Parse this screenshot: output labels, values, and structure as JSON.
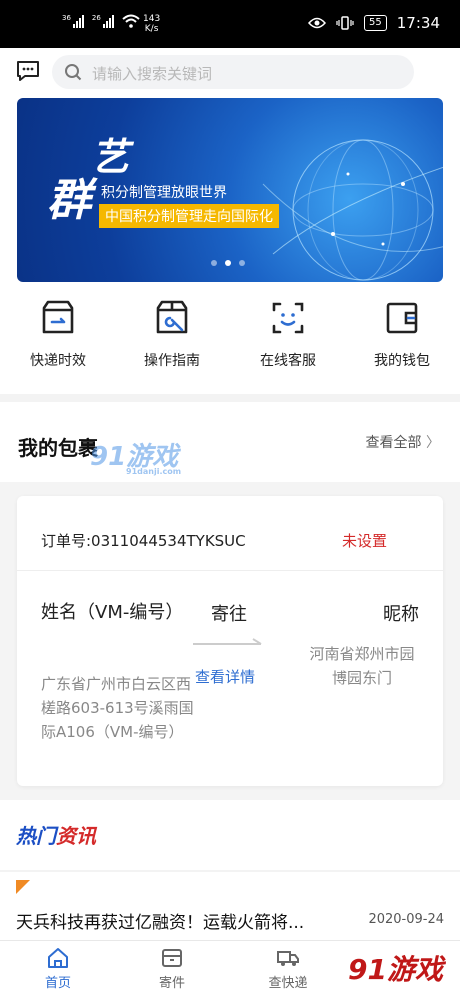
{
  "status_bar": {
    "signal1_label": "36",
    "signal2_label": "26",
    "net_speed_value": "143",
    "net_speed_unit": "K/s",
    "battery": "55",
    "time": "17:34"
  },
  "search": {
    "placeholder": "请输入搜索关键词"
  },
  "banner": {
    "glyph_top": "艺",
    "glyph_bottom": "群",
    "line1": "积分制管理放眼世界",
    "line2": "中国积分制管理走向国际化",
    "active_dot": 2,
    "dot_count": 3
  },
  "quick_actions": [
    {
      "label": "快递时效",
      "icon": "box-clock-icon"
    },
    {
      "label": "操作指南",
      "icon": "box-wrench-icon"
    },
    {
      "label": "在线客服",
      "icon": "customer-service-icon"
    },
    {
      "label": "我的钱包",
      "icon": "wallet-icon"
    }
  ],
  "packages": {
    "title": "我的包裹",
    "view_all": "查看全部",
    "watermark": "91游戏",
    "watermark_sub": "91danji.com"
  },
  "order": {
    "number_label": "订单号:0311044534TYKSUC",
    "status": "未设置",
    "sender_name": "姓名（VM-编号）",
    "sender_address": "广东省广州市白云区西槎路603-613号溪雨国际A106（VM-编号）",
    "send_to": "寄往",
    "detail_link": "查看详情",
    "receiver_name": "昵称",
    "receiver_address": "河南省郑州市园博园东门"
  },
  "news": {
    "title_part1": "热门",
    "title_part2": "资讯",
    "item_title": "天兵科技再获过亿融资！运载火箭将...",
    "item_date": "2020-09-24"
  },
  "tabbar": {
    "items": [
      {
        "label": "首页",
        "active": true
      },
      {
        "label": "寄件",
        "active": false
      },
      {
        "label": "查快递",
        "active": false
      }
    ]
  },
  "corner_logo": "91游戏",
  "colors": {
    "accent": "#2e6dd1",
    "alert": "#d42a2a",
    "banner_gold": "#f5b800"
  }
}
